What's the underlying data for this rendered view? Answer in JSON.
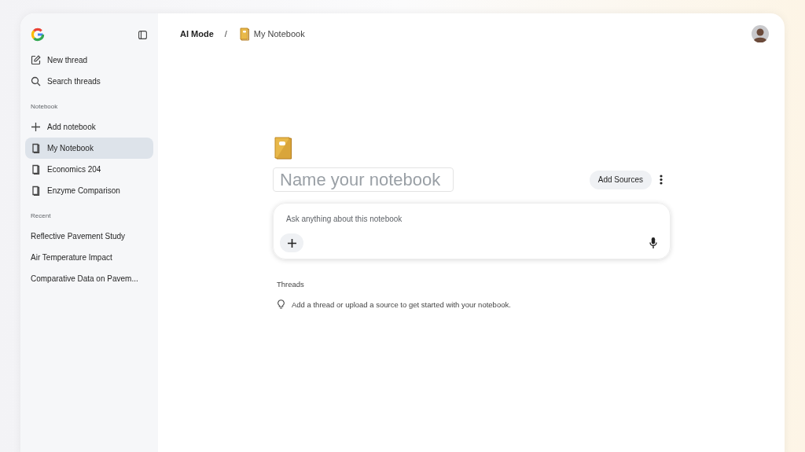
{
  "sidebar": {
    "actions": [
      {
        "kind": "edit",
        "label": "New thread"
      },
      {
        "kind": "search",
        "label": "Search threads"
      }
    ],
    "notebook_heading": "Notebook",
    "notebooks": [
      {
        "kind": "add",
        "label": "Add notebook",
        "selected": false
      },
      {
        "kind": "notebook",
        "label": "My Notebook",
        "selected": true
      },
      {
        "kind": "notebook",
        "label": "Economics 204",
        "selected": false
      },
      {
        "kind": "notebook",
        "label": "Enzyme Comparison",
        "selected": false
      }
    ],
    "recent_heading": "Recent",
    "recent": [
      "Reflective Pavement Study",
      "Air Temperature Impact",
      "Comparative Data on Pavem..."
    ]
  },
  "breadcrumb": {
    "root": "AI Mode",
    "separator": "/",
    "current": "My Notebook"
  },
  "notebook": {
    "name_placeholder": "Name your notebook",
    "add_sources": "Add Sources",
    "ask_placeholder": "Ask anything about this notebook",
    "threads_heading": "Threads",
    "threads_empty": "Add a thread or upload a source to get started with your notebook."
  }
}
